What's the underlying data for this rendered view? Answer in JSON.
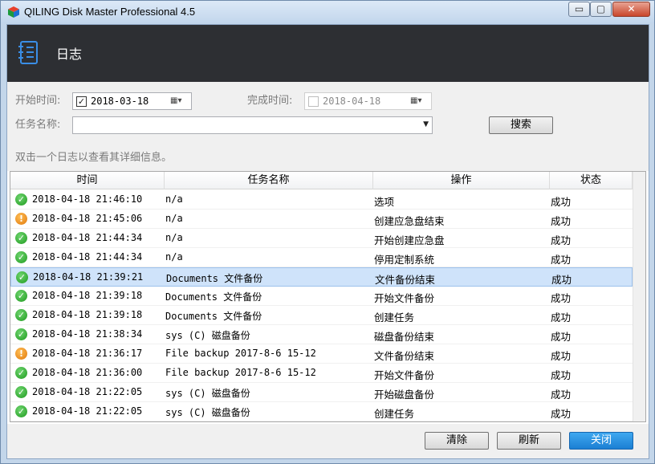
{
  "window": {
    "title": "QILING Disk Master Professional 4.5",
    "controls": {
      "minimize": "▭",
      "maximize": "▢",
      "close": "✕"
    }
  },
  "header": {
    "title": "日志",
    "icon": "log-book-icon"
  },
  "filters": {
    "start_label": "开始时间:",
    "start_checked": true,
    "start_value": "2018-03-18",
    "end_label": "完成时间:",
    "end_checked": false,
    "end_value": "2018-04-18",
    "task_label": "任务名称:",
    "task_value": "",
    "search_button": "搜索"
  },
  "hint": "双击一个日志以查看其详细信息。",
  "grid": {
    "columns": [
      "时间",
      "任务名称",
      "操作",
      "状态"
    ],
    "rows": [
      {
        "icon": "success-icon",
        "time": "2018-04-18  21:46:10",
        "task": "n/a",
        "op": "选项",
        "state": "成功",
        "selected": false
      },
      {
        "icon": "warning-icon",
        "time": "2018-04-18  21:45:06",
        "task": "n/a",
        "op": "创建应急盘结束",
        "state": "成功",
        "selected": false
      },
      {
        "icon": "success-icon",
        "time": "2018-04-18  21:44:34",
        "task": "n/a",
        "op": "开始创建应急盘",
        "state": "成功",
        "selected": false
      },
      {
        "icon": "success-icon",
        "time": "2018-04-18  21:44:34",
        "task": "n/a",
        "op": "停用定制系统",
        "state": "成功",
        "selected": false
      },
      {
        "icon": "success-icon",
        "time": "2018-04-18  21:39:21",
        "task": "Documents 文件备份",
        "op": "文件备份结束",
        "state": "成功",
        "selected": true
      },
      {
        "icon": "success-icon",
        "time": "2018-04-18  21:39:18",
        "task": "Documents 文件备份",
        "op": "开始文件备份",
        "state": "成功",
        "selected": false
      },
      {
        "icon": "success-icon",
        "time": "2018-04-18  21:39:18",
        "task": "Documents 文件备份",
        "op": "创建任务",
        "state": "成功",
        "selected": false
      },
      {
        "icon": "success-icon",
        "time": "2018-04-18  21:38:34",
        "task": "sys (C) 磁盘备份",
        "op": "磁盘备份结束",
        "state": "成功",
        "selected": false
      },
      {
        "icon": "warning-icon",
        "time": "2018-04-18  21:36:17",
        "task": "File backup 2017-8-6 15-12",
        "op": "文件备份结束",
        "state": "成功",
        "selected": false
      },
      {
        "icon": "success-icon",
        "time": "2018-04-18  21:36:00",
        "task": "File backup 2017-8-6 15-12",
        "op": "开始文件备份",
        "state": "成功",
        "selected": false
      },
      {
        "icon": "success-icon",
        "time": "2018-04-18  21:22:05",
        "task": "sys (C) 磁盘备份",
        "op": "开始磁盘备份",
        "state": "成功",
        "selected": false
      },
      {
        "icon": "success-icon",
        "time": "2018-04-18  21:22:05",
        "task": "sys (C) 磁盘备份",
        "op": "创建任务",
        "state": "成功",
        "selected": false
      }
    ]
  },
  "buttons": {
    "clear": "清除",
    "refresh": "刷新",
    "close": "关闭"
  },
  "colors": {
    "header_bg": "#2d2f33",
    "selection": "#cfe3fa",
    "primary": "#1b7fd3",
    "success": "#1f9a1f",
    "warning": "#e0780b"
  }
}
